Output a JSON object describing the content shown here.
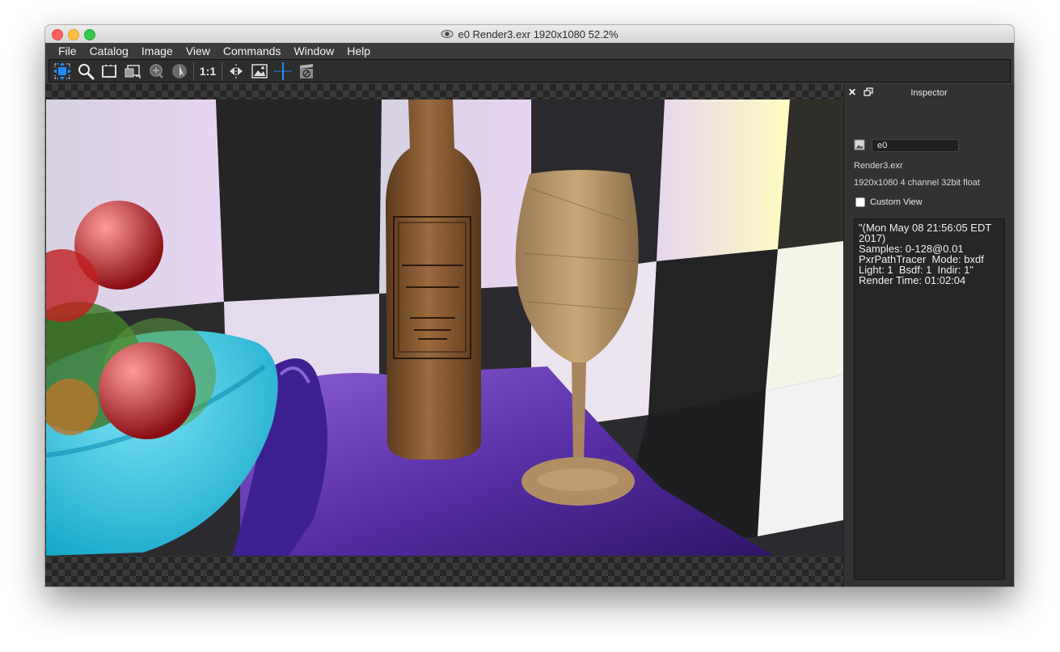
{
  "window": {
    "title": "e0 Render3.exr 1920x1080 52.2%"
  },
  "menu": {
    "items": [
      "File",
      "Catalog",
      "Image",
      "View",
      "Commands",
      "Window",
      "Help"
    ]
  },
  "toolbar": {
    "tools": [
      "pan-icon",
      "zoom-icon",
      "crop-icon",
      "region-icon",
      "magnify-region-icon",
      "color-picker-icon"
    ],
    "one_to_one_label": "1:1",
    "extra_tools": [
      "flip-icon",
      "image-icon",
      "crosshair-icon",
      "clapper-icon"
    ],
    "accent_color": "#1e8cff"
  },
  "inspector": {
    "title": "Inspector",
    "image_name": "e0",
    "file_name": "Render3.exr",
    "image_info": "1920x1080 4 channel 32bit float",
    "custom_view_label": "Custom View",
    "custom_view_checked": false,
    "metadata": "\"(Mon May 08 21:56:05 EDT 2017)\nSamples: 0-128@0.01\nPxrPathTracer  Mode: bxdf\nLight: 1  Bsdf: 1  Indir: 1\"\nRender Time: 01:02:04"
  }
}
